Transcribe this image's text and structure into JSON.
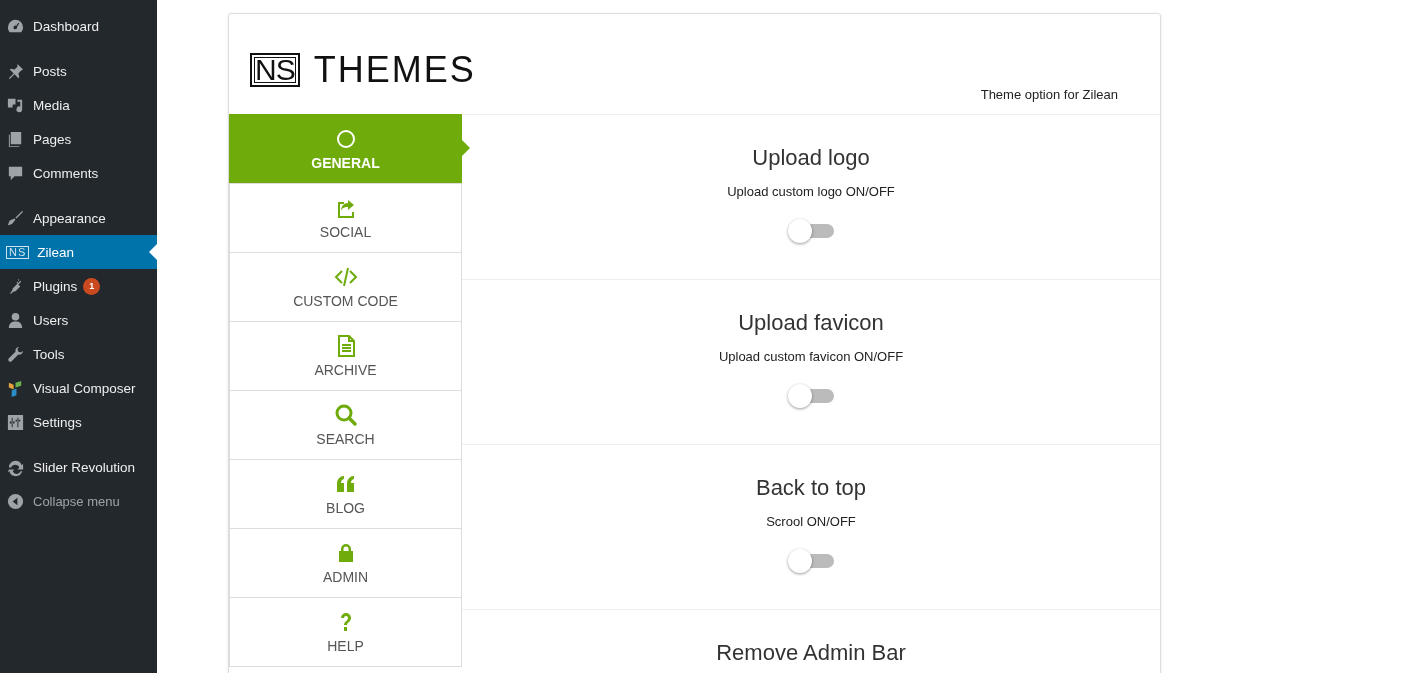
{
  "sidebar": {
    "groups": [
      [
        {
          "label": "Dashboard",
          "selected": false
        }
      ],
      [
        {
          "label": "Posts",
          "selected": false
        },
        {
          "label": "Media",
          "selected": false
        },
        {
          "label": "Pages",
          "selected": false
        },
        {
          "label": "Comments",
          "selected": false
        }
      ],
      [
        {
          "label": "Appearance",
          "selected": false
        },
        {
          "label": "Zilean",
          "selected": true,
          "icon_text": "NS"
        },
        {
          "label": "Plugins",
          "selected": false,
          "badge": "1"
        },
        {
          "label": "Users",
          "selected": false
        },
        {
          "label": "Tools",
          "selected": false
        },
        {
          "label": "Visual Composer",
          "selected": false
        },
        {
          "label": "Settings",
          "selected": false
        }
      ],
      [
        {
          "label": "Slider Revolution",
          "selected": false
        },
        {
          "label": "Collapse menu",
          "selected": false,
          "kind": "collapse"
        }
      ]
    ]
  },
  "header": {
    "logo_mark": "NS",
    "logo_text": "THEMES",
    "subtitle": "Theme option for Zilean"
  },
  "tabs": [
    {
      "label": "GENERAL",
      "selected": true
    },
    {
      "label": "SOCIAL",
      "selected": false
    },
    {
      "label": "CUSTOM CODE",
      "selected": false
    },
    {
      "label": "ARCHIVE",
      "selected": false
    },
    {
      "label": "SEARCH",
      "selected": false
    },
    {
      "label": "BLOG",
      "selected": false
    },
    {
      "label": "ADMIN",
      "selected": false
    },
    {
      "label": "HELP",
      "selected": false
    }
  ],
  "options": [
    {
      "title": "Upload logo",
      "description": "Upload custom logo ON/OFF",
      "on": false
    },
    {
      "title": "Upload favicon",
      "description": "Upload custom favicon ON/OFF",
      "on": false
    },
    {
      "title": "Back to top",
      "description": "Scrool ON/OFF",
      "on": false
    },
    {
      "title": "Remove Admin Bar"
    }
  ]
}
